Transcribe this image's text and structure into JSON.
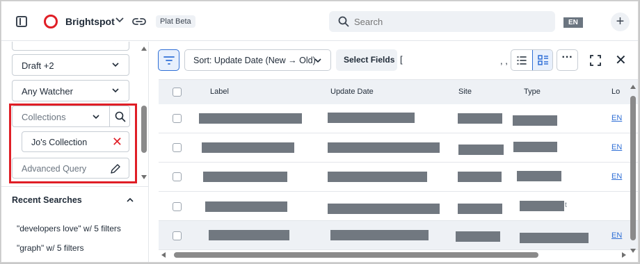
{
  "header": {
    "brand": "Brightspot",
    "badge": "Plat Beta",
    "search_placeholder": "Search",
    "lang": "EN",
    "add": "+"
  },
  "sidebar": {
    "filters": [
      {
        "label": "Draft +2"
      },
      {
        "label": "Any Watcher"
      }
    ],
    "collections": {
      "placeholder": "Collections",
      "selected": "Jo's Collection",
      "remove": "✕"
    },
    "advanced_query": "Advanced Query",
    "recent": {
      "title": "Recent Searches",
      "items": [
        "\"developers love\" w/ 5 filters",
        "\"graph\" w/ 5 filters"
      ]
    }
  },
  "toolbar": {
    "sort_label": "Sort: Update Date (New → Old)",
    "select_fields": "Select Fields",
    "bracket": "[",
    "commas": ", ,",
    "more": "···",
    "close": "✕"
  },
  "table": {
    "columns": [
      "Label",
      "Update Date",
      "Site",
      "Type",
      "Lo"
    ],
    "rows": [
      {
        "link": "EN",
        "stray": "",
        "highlighted": false
      },
      {
        "link": "EN",
        "stray": "",
        "highlighted": false
      },
      {
        "link": "EN",
        "stray": "",
        "highlighted": false
      },
      {
        "link": "",
        "stray": "t",
        "highlighted": false
      },
      {
        "link": "EN",
        "stray": "",
        "highlighted": true
      }
    ]
  },
  "colors": {
    "accent": "#2f6fd6",
    "brand_red": "#e01e26",
    "redacted": "#717880"
  }
}
